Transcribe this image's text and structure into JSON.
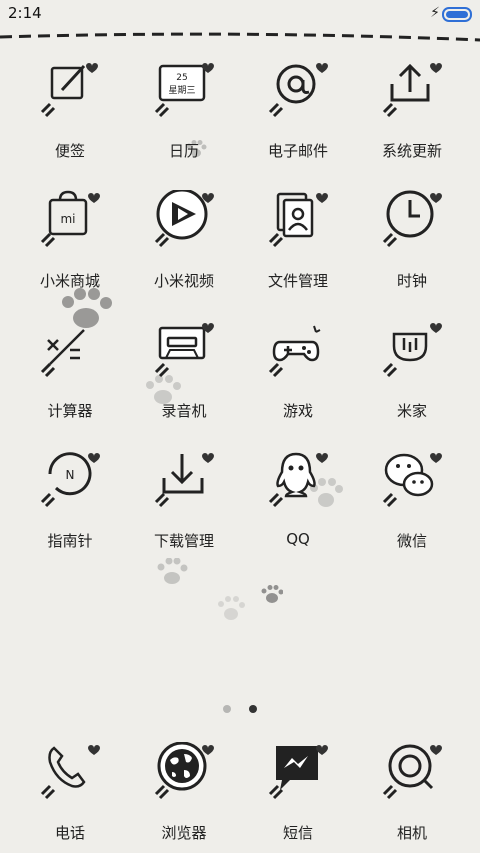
{
  "status_bar": {
    "time": "2:14",
    "charging_icon": "lightning-bolt-icon",
    "battery_icon": "battery-icon",
    "battery_color": "#2f6fd6"
  },
  "apps": [
    {
      "label": "便签",
      "icon": "notes-icon"
    },
    {
      "label": "日历",
      "icon": "calendar-icon",
      "date_number": "25",
      "date_weekday": "星期三"
    },
    {
      "label": "电子邮件",
      "icon": "email-at-icon"
    },
    {
      "label": "系统更新",
      "icon": "system-update-icon"
    },
    {
      "label": "小米商城",
      "icon": "mi-store-bag-icon",
      "badge": "mi"
    },
    {
      "label": "小米视频",
      "icon": "video-play-icon"
    },
    {
      "label": "文件管理",
      "icon": "file-manager-icon"
    },
    {
      "label": "时钟",
      "icon": "clock-icon"
    },
    {
      "label": "计算器",
      "icon": "calculator-icon"
    },
    {
      "label": "录音机",
      "icon": "cassette-recorder-icon"
    },
    {
      "label": "游戏",
      "icon": "gamepad-icon"
    },
    {
      "label": "米家",
      "icon": "mijia-icon"
    },
    {
      "label": "指南针",
      "icon": "compass-icon",
      "compass_letter": "N"
    },
    {
      "label": "下载管理",
      "icon": "download-icon"
    },
    {
      "label": "QQ",
      "icon": "qq-penguin-icon"
    },
    {
      "label": "微信",
      "icon": "wechat-icon"
    }
  ],
  "page_indicator": {
    "pages": 2,
    "current": 2
  },
  "dock": [
    {
      "label": "电话",
      "icon": "phone-icon"
    },
    {
      "label": "浏览器",
      "icon": "browser-globe-icon"
    },
    {
      "label": "短信",
      "icon": "messages-icon"
    },
    {
      "label": "相机",
      "icon": "camera-icon"
    }
  ]
}
